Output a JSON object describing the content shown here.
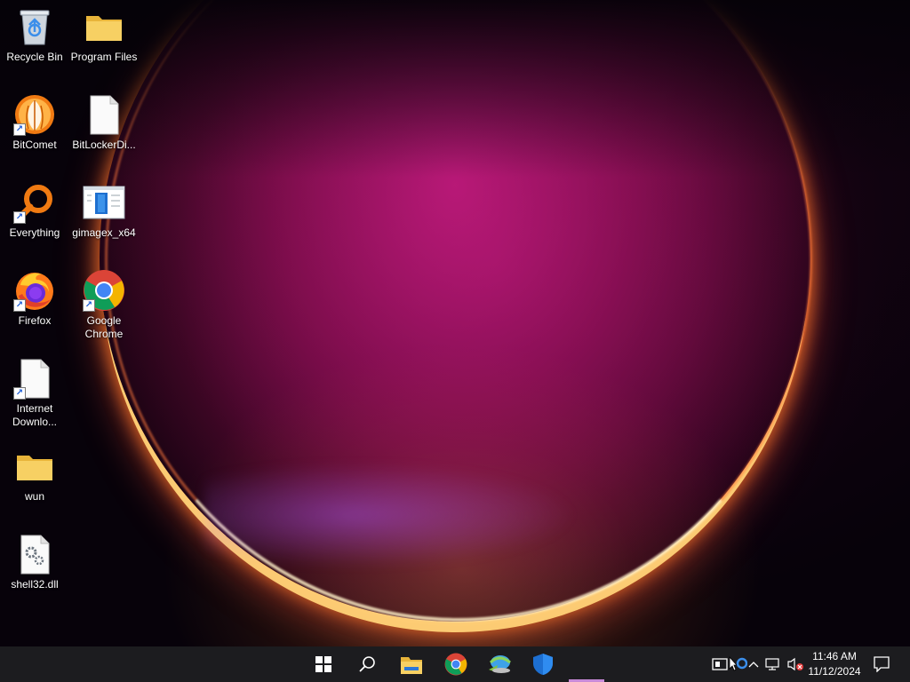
{
  "desktop": {
    "icons": [
      {
        "label": "Recycle Bin",
        "icon": "recycle-bin-icon"
      },
      {
        "label": "Program Files",
        "icon": "folder-icon"
      },
      {
        "label": "BitComet",
        "icon": "bitcomet-icon"
      },
      {
        "label": "BitLockerDi...",
        "icon": "blank-file-icon"
      },
      {
        "label": "Everything",
        "icon": "everything-search-icon"
      },
      {
        "label": "gimagex_x64",
        "icon": "window-app-icon"
      },
      {
        "label": "Firefox",
        "icon": "firefox-icon"
      },
      {
        "label": "Google Chrome",
        "icon": "chrome-icon"
      },
      {
        "label": "Internet Downlo...",
        "icon": "blank-file-icon"
      },
      {
        "label": "wun",
        "icon": "folder-icon"
      },
      {
        "label": "shell32.dll",
        "icon": "dll-file-icon"
      }
    ]
  },
  "taskbar": {
    "pinned": [
      {
        "name": "start-button",
        "icon": "windows-logo-icon"
      },
      {
        "name": "search-button",
        "icon": "search-icon"
      },
      {
        "name": "file-explorer-button",
        "icon": "file-explorer-icon"
      },
      {
        "name": "chrome-button",
        "icon": "chrome-icon"
      },
      {
        "name": "internet-download-manager-button",
        "icon": "idm-icon"
      },
      {
        "name": "windows-security-button",
        "icon": "shield-icon"
      }
    ],
    "tray": {
      "time": "11:46 AM",
      "date": "11/12/2024"
    }
  },
  "colors": {
    "taskbar_bg": "#1c1c1f",
    "accent": "#3b8eea"
  }
}
